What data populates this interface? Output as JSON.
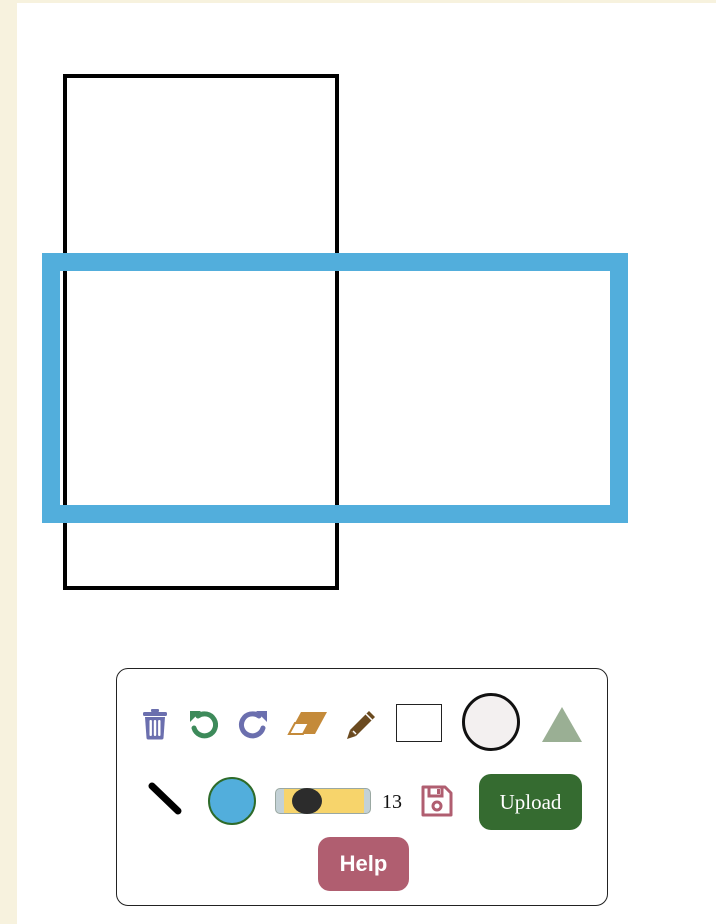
{
  "canvas": {
    "shapes": [
      {
        "type": "rectangle",
        "stroke_color": "#000000"
      },
      {
        "type": "rectangle",
        "stroke_color": "#52aedc"
      }
    ]
  },
  "toolbar": {
    "tools": [
      {
        "icon": "trash-icon",
        "color": "#6b6fae"
      },
      {
        "icon": "undo-icon",
        "color": "#3d8a5a"
      },
      {
        "icon": "redo-icon",
        "color": "#6b6fae"
      },
      {
        "icon": "eraser-icon",
        "color": "#c48a3a"
      },
      {
        "icon": "pencil-icon",
        "color": "#6b4a1f"
      },
      {
        "icon": "rectangle-tool-icon"
      },
      {
        "icon": "circle-tool-icon"
      },
      {
        "icon": "triangle-tool-icon",
        "color": "#9aaf94"
      },
      {
        "icon": "line-tool-icon"
      },
      {
        "icon": "save-icon",
        "color": "#b05e70"
      }
    ],
    "current_color": "#52aedc",
    "brush_size": "13",
    "upload_label": "Upload",
    "help_label": "Help"
  },
  "colors": {
    "page_border": "#f7f2de",
    "upload_bg": "#356b30",
    "help_bg": "#b05e70"
  }
}
